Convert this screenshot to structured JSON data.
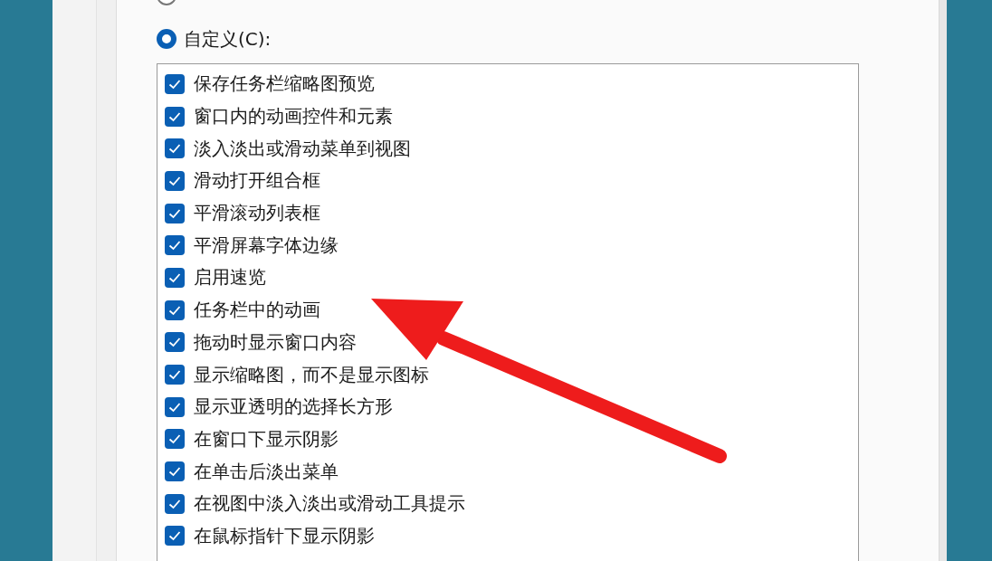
{
  "radios": [
    {
      "selected": false
    },
    {
      "label": "自定义(C):",
      "selected": true
    }
  ],
  "effects": [
    {
      "label": "保存任务栏缩略图预览",
      "checked": true
    },
    {
      "label": "窗口内的动画控件和元素",
      "checked": true
    },
    {
      "label": "淡入淡出或滑动菜单到视图",
      "checked": true
    },
    {
      "label": "滑动打开组合框",
      "checked": true
    },
    {
      "label": "平滑滚动列表框",
      "checked": true
    },
    {
      "label": "平滑屏幕字体边缘",
      "checked": true
    },
    {
      "label": "启用速览",
      "checked": true
    },
    {
      "label": "任务栏中的动画",
      "checked": true
    },
    {
      "label": "拖动时显示窗口内容",
      "checked": true
    },
    {
      "label": "显示缩略图，而不是显示图标",
      "checked": true
    },
    {
      "label": "显示亚透明的选择长方形",
      "checked": true
    },
    {
      "label": "在窗口下显示阴影",
      "checked": true
    },
    {
      "label": "在单击后淡出菜单",
      "checked": true
    },
    {
      "label": "在视图中淡入淡出或滑动工具提示",
      "checked": true
    },
    {
      "label": "在鼠标指针下显示阴影",
      "checked": true
    }
  ]
}
